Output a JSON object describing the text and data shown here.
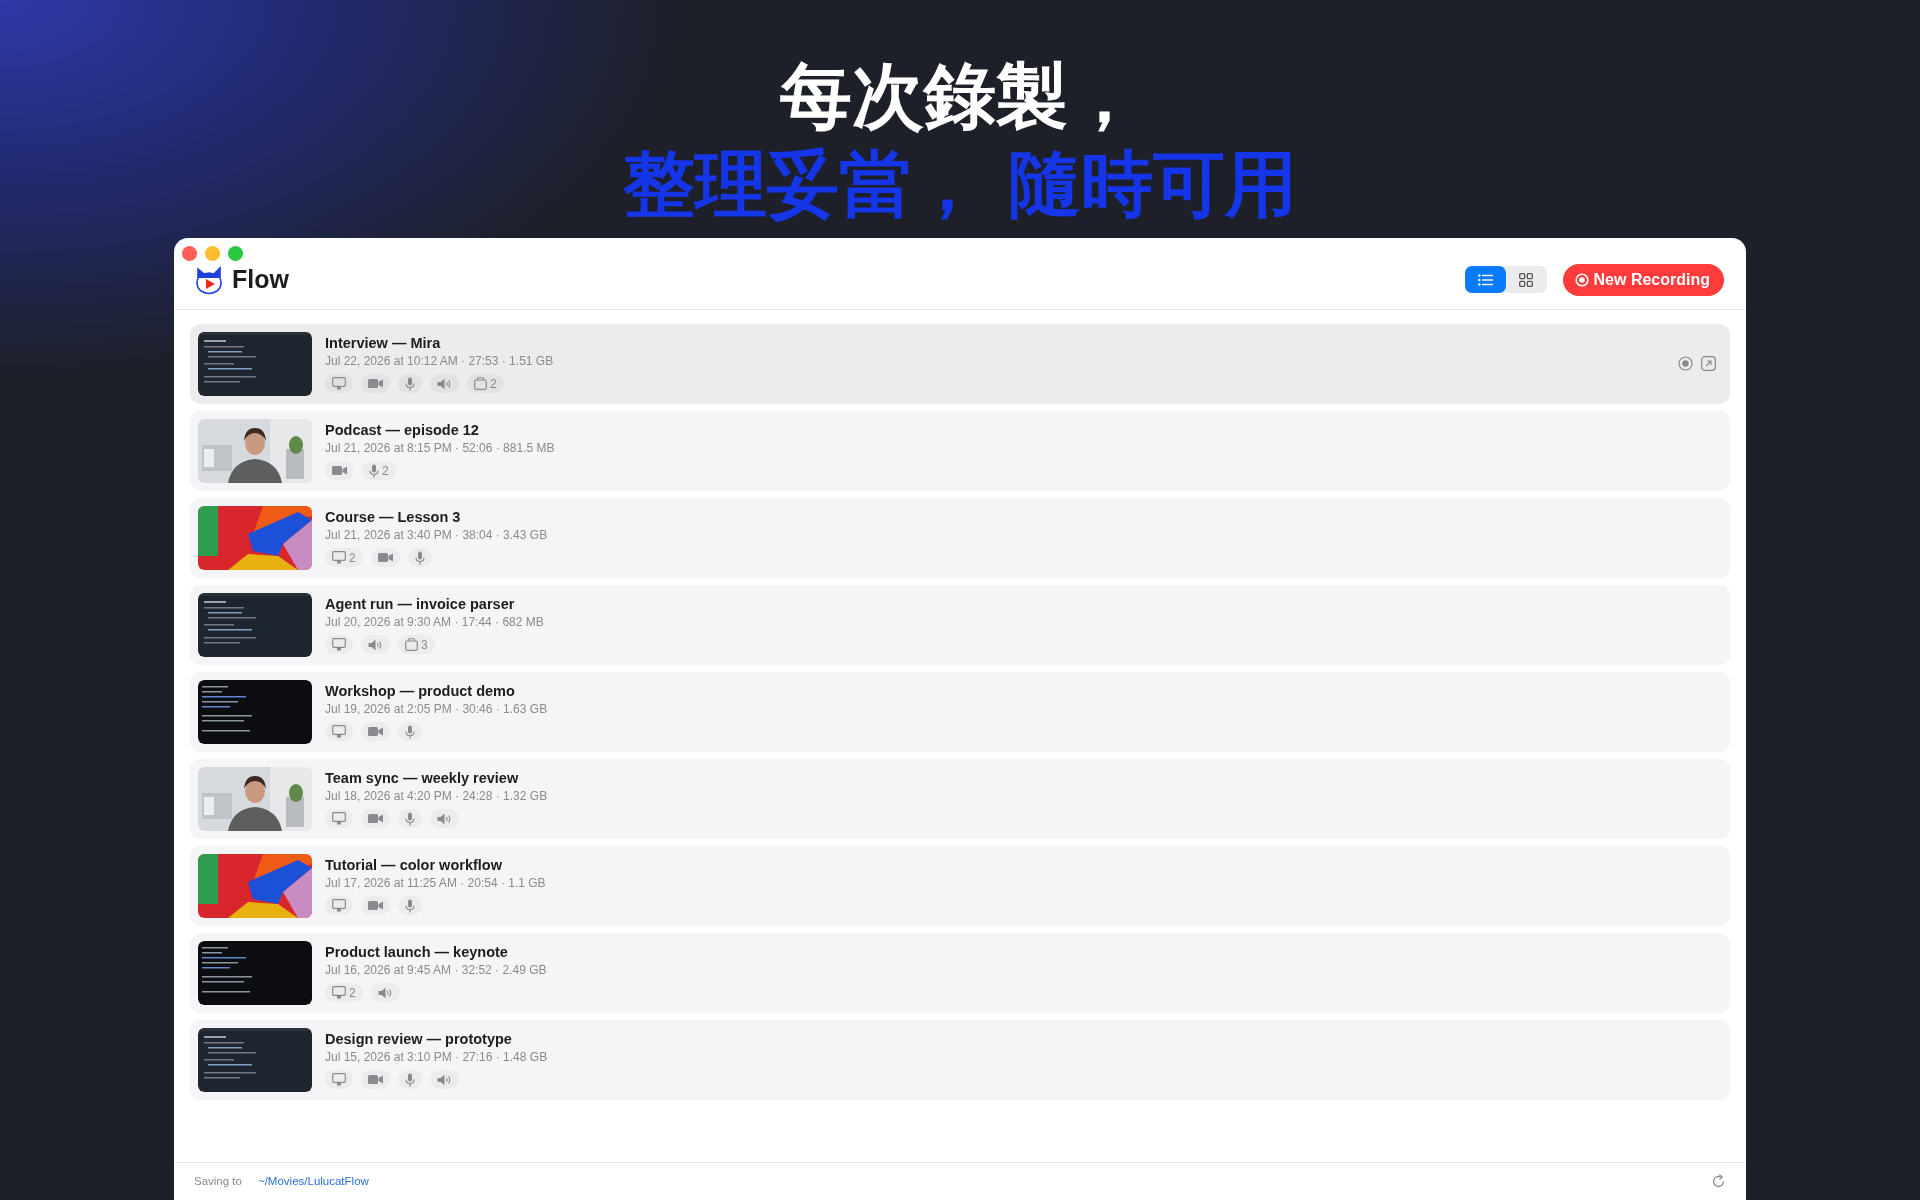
{
  "headline": {
    "line_1": "每次錄製，",
    "line_2": "整理妥當， 隨時可用"
  },
  "window": {
    "app_name": "Flow",
    "view_toggle": [
      {
        "kind": "list",
        "selected": true
      },
      {
        "kind": "grid",
        "selected": false
      }
    ],
    "new_button": "New Recording",
    "recordings": [
      {
        "title": "Interview — Mira",
        "meta": "Jul 22, 2026 at 10:12 AM · 27:53 · 1.51 GB",
        "kind": "code",
        "selected": true,
        "chips": [
          {
            "kind": "screen"
          },
          {
            "kind": "camera"
          },
          {
            "kind": "mic"
          },
          {
            "kind": "speaker"
          },
          {
            "kind": "window",
            "count": "2"
          }
        ]
      },
      {
        "title": "Podcast — episode 12",
        "meta": "Jul 21, 2026 at 8:15 PM · 52:06 · 881.5 MB",
        "selected": false,
        "chips": [
          {
            "kind": "camera"
          },
          {
            "kind": "mic",
            "count": "2"
          }
        ]
      },
      {
        "title": "Course — Lesson 3",
        "meta": "Jul 21, 2026 at 3:40 PM · 38:04 · 3.43 GB",
        "kind": "shapes",
        "selected": false,
        "chips": [
          {
            "kind": "screen",
            "count": "2"
          },
          {
            "kind": "camera"
          },
          {
            "kind": "mic"
          }
        ]
      },
      {
        "title": "Agent run — invoice parser",
        "meta": "Jul 20, 2026 at 9:30 AM · 17:44 · 682 MB",
        "kind": "code",
        "selected": false,
        "chips": [
          {
            "kind": "screen"
          },
          {
            "kind": "speaker"
          },
          {
            "kind": "window",
            "count": "3"
          }
        ]
      },
      {
        "title": "Workshop — product demo",
        "meta": "Jul 19, 2026 at 2:05 PM · 30:46 · 1.63 GB",
        "kind": "terminal",
        "selected": false,
        "chips": [
          {
            "kind": "screen"
          },
          {
            "kind": "camera"
          },
          {
            "kind": "mic"
          }
        ]
      },
      {
        "title": "Team sync — weekly review",
        "meta": "Jul 18, 2026 at 4:20 PM · 24:28 · 1.32 GB",
        "selected": false,
        "chips": [
          {
            "kind": "screen"
          },
          {
            "kind": "camera"
          },
          {
            "kind": "mic"
          },
          {
            "kind": "speaker"
          }
        ]
      },
      {
        "title": "Tutorial — color workflow",
        "meta": "Jul 17, 2026 at 11:25 AM · 20:54 · 1.1 GB",
        "kind": "shapes",
        "selected": false,
        "chips": [
          {
            "kind": "screen"
          },
          {
            "kind": "camera"
          },
          {
            "kind": "mic"
          }
        ]
      },
      {
        "title": "Product launch — keynote",
        "meta": "Jul 16, 2026 at 9:45 AM · 32:52 · 2.49 GB",
        "kind": "terminal",
        "selected": false,
        "chips": [
          {
            "kind": "screen",
            "count": "2"
          },
          {
            "kind": "speaker"
          }
        ]
      },
      {
        "title": "Design review — prototype",
        "meta": "Jul 15, 2026 at 3:10 PM · 27:16 · 1.48 GB",
        "kind": "code",
        "selected": false,
        "chips": [
          {
            "kind": "screen"
          },
          {
            "kind": "camera"
          },
          {
            "kind": "mic"
          },
          {
            "kind": "speaker"
          }
        ]
      }
    ],
    "footer": {
      "label": "Saving to",
      "path": "~/Movies/LulucatFlow"
    }
  }
}
